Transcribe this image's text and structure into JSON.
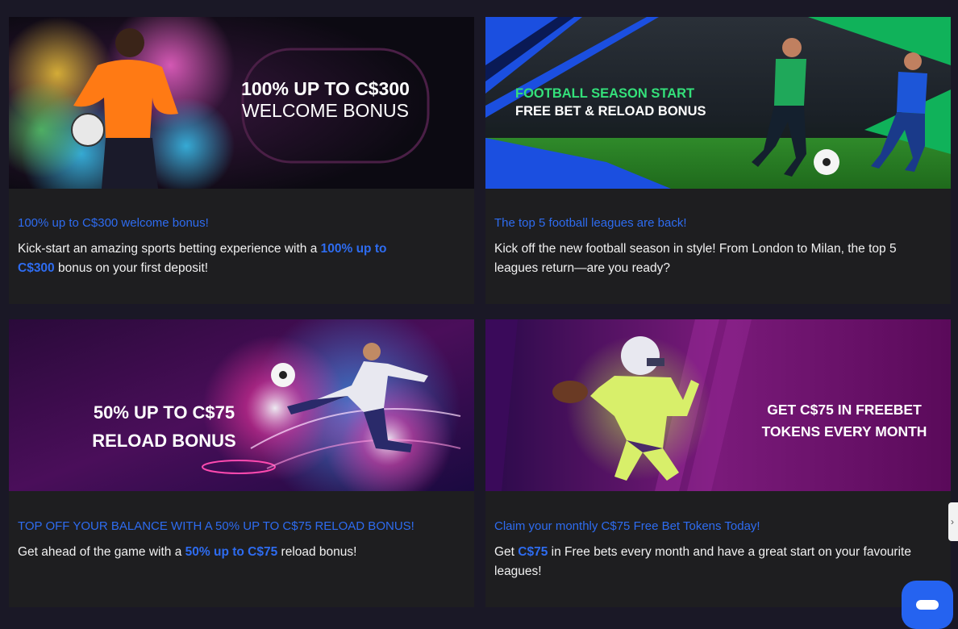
{
  "cards": [
    {
      "banner": {
        "line1": "100% UP TO C$300",
        "line2": "WELCOME BONUS"
      },
      "title": "100% up to C$300 welcome bonus!",
      "desc": {
        "before": "Kick-start an amazing sports betting experience with a ",
        "highlight": "100% up to C$300",
        "after": " bonus on your first deposit!"
      }
    },
    {
      "banner": {
        "line1": "FOOTBALL SEASON START",
        "line2": "FREE BET & RELOAD BONUS"
      },
      "title": "The top 5 football leagues are back!",
      "desc": {
        "text": "Kick off the new football season in style! From London to Milan, the top 5 leagues return—are you ready?"
      }
    },
    {
      "banner": {
        "line1": "50% UP TO C$75",
        "line2": "RELOAD BONUS"
      },
      "title": "TOP OFF YOUR BALANCE WITH A 50% UP TO C$75 RELOAD BONUS!",
      "desc": {
        "before": "Get ahead of the game with a ",
        "highlight": "50% up to C$75",
        "after": " reload bonus!"
      }
    },
    {
      "banner": {
        "line1": "GET C$75 IN FREEBET",
        "line2": "TOKENS EVERY MONTH"
      },
      "title": "Claim your monthly C$75 Free Bet Tokens Today!",
      "desc": {
        "before": "Get ",
        "highlight": "C$75",
        "after": " in Free bets every month and have a great start on your favourite leagues!"
      }
    }
  ],
  "colors": {
    "accent": "#2e6cf0",
    "card_bg": "#1e1e20",
    "page_bg": "#1a1826",
    "chat_button": "#2563f0"
  },
  "icons": {
    "chat": "chat-bubble-icon",
    "side_tab": "chevron-left-icon"
  },
  "side_tab_glyph": "›"
}
